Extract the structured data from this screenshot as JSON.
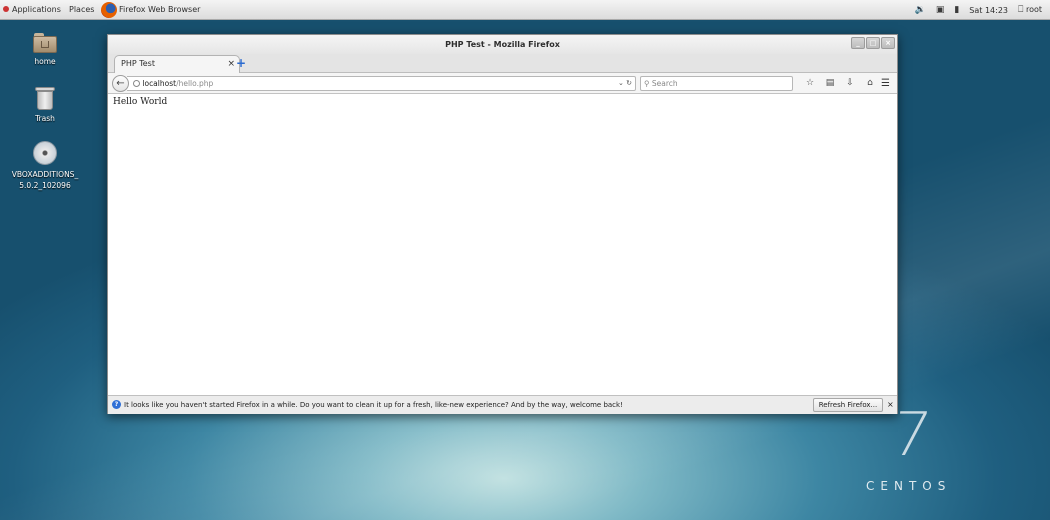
{
  "top_panel": {
    "applications": "Applications",
    "places": "Places",
    "active_app": "Firefox Web Browser",
    "clock": "Sat 14:23",
    "user": "root",
    "icons": [
      "volume-icon",
      "network-icon",
      "battery-icon",
      "user-icon"
    ]
  },
  "desktop": {
    "icons": [
      {
        "label": "home",
        "icon": "folder-home-icon"
      },
      {
        "label": "Trash",
        "icon": "trash-icon"
      },
      {
        "label": "VBOXADDITIONS_ 5.0.2_102096",
        "icon": "cd-icon"
      }
    ]
  },
  "window": {
    "title": "PHP Test - Mozilla Firefox",
    "tab_title": "PHP Test",
    "url_host": "localhost",
    "url_path": "/hello.php",
    "search_placeholder": "Search",
    "page_text": "Hello World"
  },
  "notification": {
    "text": "It looks like you haven't started Firefox in a while. Do you want to clean it up for a fresh, like-new experience? And by the way, welcome back!",
    "button": "Refresh Firefox..."
  },
  "branding": {
    "seven": "7",
    "word": "CENTOS"
  },
  "colors": {
    "firefox_accent": "#2a6ad0",
    "desktop_bg": "#1f5f80"
  }
}
